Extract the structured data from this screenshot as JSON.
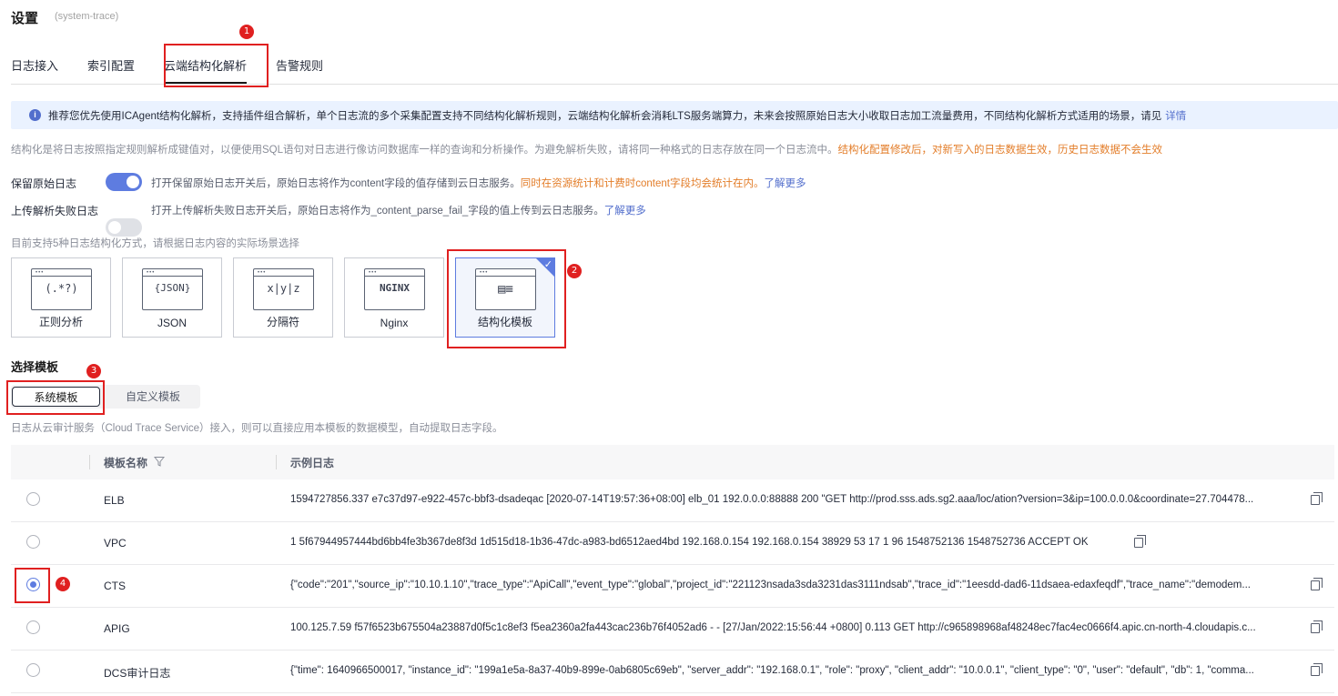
{
  "header": {
    "title": "设置",
    "subtitle": "(system-trace)"
  },
  "tabs": [
    {
      "label": "日志接入"
    },
    {
      "label": "索引配置"
    },
    {
      "label": "云端结构化解析"
    },
    {
      "label": "告警规则"
    }
  ],
  "banner": {
    "text": "推荐您优先使用ICAgent结构化解析，支持插件组合解析，单个日志流的多个采集配置支持不同结构化解析规则，云端结构化解析会消耗LTS服务端算力，未来会按照原始日志大小收取日志加工流量费用，不同结构化解析方式适用的场景，请见",
    "link": "详情"
  },
  "description": {
    "text": "结构化是将日志按照指定规则解析成键值对，以便使用SQL语句对日志进行像访问数据库一样的查询和分析操作。为避免解析失败，请将同一种格式的日志存放在同一个日志流中。",
    "warning": "结构化配置修改后，对新写入的日志数据生效，历史日志数据不会生效"
  },
  "keep_raw": {
    "label": "保留原始日志",
    "desc": "打开保留原始日志开关后，原始日志将作为content字段的值存储到云日志服务。",
    "warning": "同时在资源统计和计费时content字段均会统计在内。",
    "link": "了解更多"
  },
  "upload_fail": {
    "label": "上传解析失败日志",
    "desc": "打开上传解析失败日志开关后，原始日志将作为_content_parse_fail_字段的值上传到云日志服务。",
    "link": "了解更多"
  },
  "support_text": "目前支持5种日志结构化方式，请根据日志内容的实际场景选择",
  "methods": [
    {
      "label": "正则分析",
      "glyph": "(.*?)"
    },
    {
      "label": "JSON",
      "glyph": "{JSON}"
    },
    {
      "label": "分隔符",
      "glyph": "x|y|z"
    },
    {
      "label": "Nginx",
      "glyph": "NGINX"
    },
    {
      "label": "结构化模板",
      "glyph": "▤≡"
    }
  ],
  "select_template": {
    "title": "选择模板",
    "system_tab": "系统模板",
    "custom_tab": "自定义模板",
    "hint": "日志从云审计服务（Cloud Trace Service）接入，则可以直接应用本模板的数据模型，自动提取日志字段。"
  },
  "table": {
    "headers": {
      "name": "模板名称",
      "log": "示例日志"
    },
    "rows": [
      {
        "name": "ELB",
        "log": "1594727856.337 e7c37d97-e922-457c-bbf3-dsadeqac [2020-07-14T19:57:36+08:00] elb_01 192.0.0.0:88888 200 \"GET http://prod.sss.ads.sg2.aaa/loc/ation?version=3&ip=100.0.0.0&coordinate=27.704478...",
        "selected": false
      },
      {
        "name": "VPC",
        "log": "1 5f67944957444bd6bb4fe3b367de8f3d 1d515d18-1b36-47dc-a983-bd6512aed4bd 192.168.0.154 192.168.0.154 38929 53 17 1 96 1548752136 1548752736 ACCEPT OK",
        "selected": false
      },
      {
        "name": "CTS",
        "log": "{\"code\":\"201\",\"source_ip\":\"10.10.1.10\",\"trace_type\":\"ApiCall\",\"event_type\":\"global\",\"project_id\":\"221123nsada3sda3231das3111ndsab\",\"trace_id\":\"1eesdd-dad6-11dsaea-edaxfeqdf\",\"trace_name\":\"demodem...",
        "selected": true
      },
      {
        "name": "APIG",
        "log": "100.125.7.59 f57f6523b675504a23887d0f5c1c8ef3 f5ea2360a2fa443cac236b76f4052ad6 - - [27/Jan/2022:15:56:44 +0800] 0.113 GET http://c965898968af48248ec7fac4ec0666f4.apic.cn-north-4.cloudapis.c...",
        "selected": false
      },
      {
        "name": "DCS审计日志",
        "log": "{\"time\": 1640966500017, \"instance_id\": \"199a1e5a-8a37-40b9-899e-0ab6805c69eb\", \"server_addr\": \"192.168.0.1\", \"role\": \"proxy\", \"client_addr\": \"10.0.0.1\", \"client_type\": \"0\", \"user\": \"default\", \"db\": 1, \"comma...",
        "selected": false
      }
    ]
  },
  "annotations": [
    "1",
    "2",
    "3",
    "4"
  ]
}
